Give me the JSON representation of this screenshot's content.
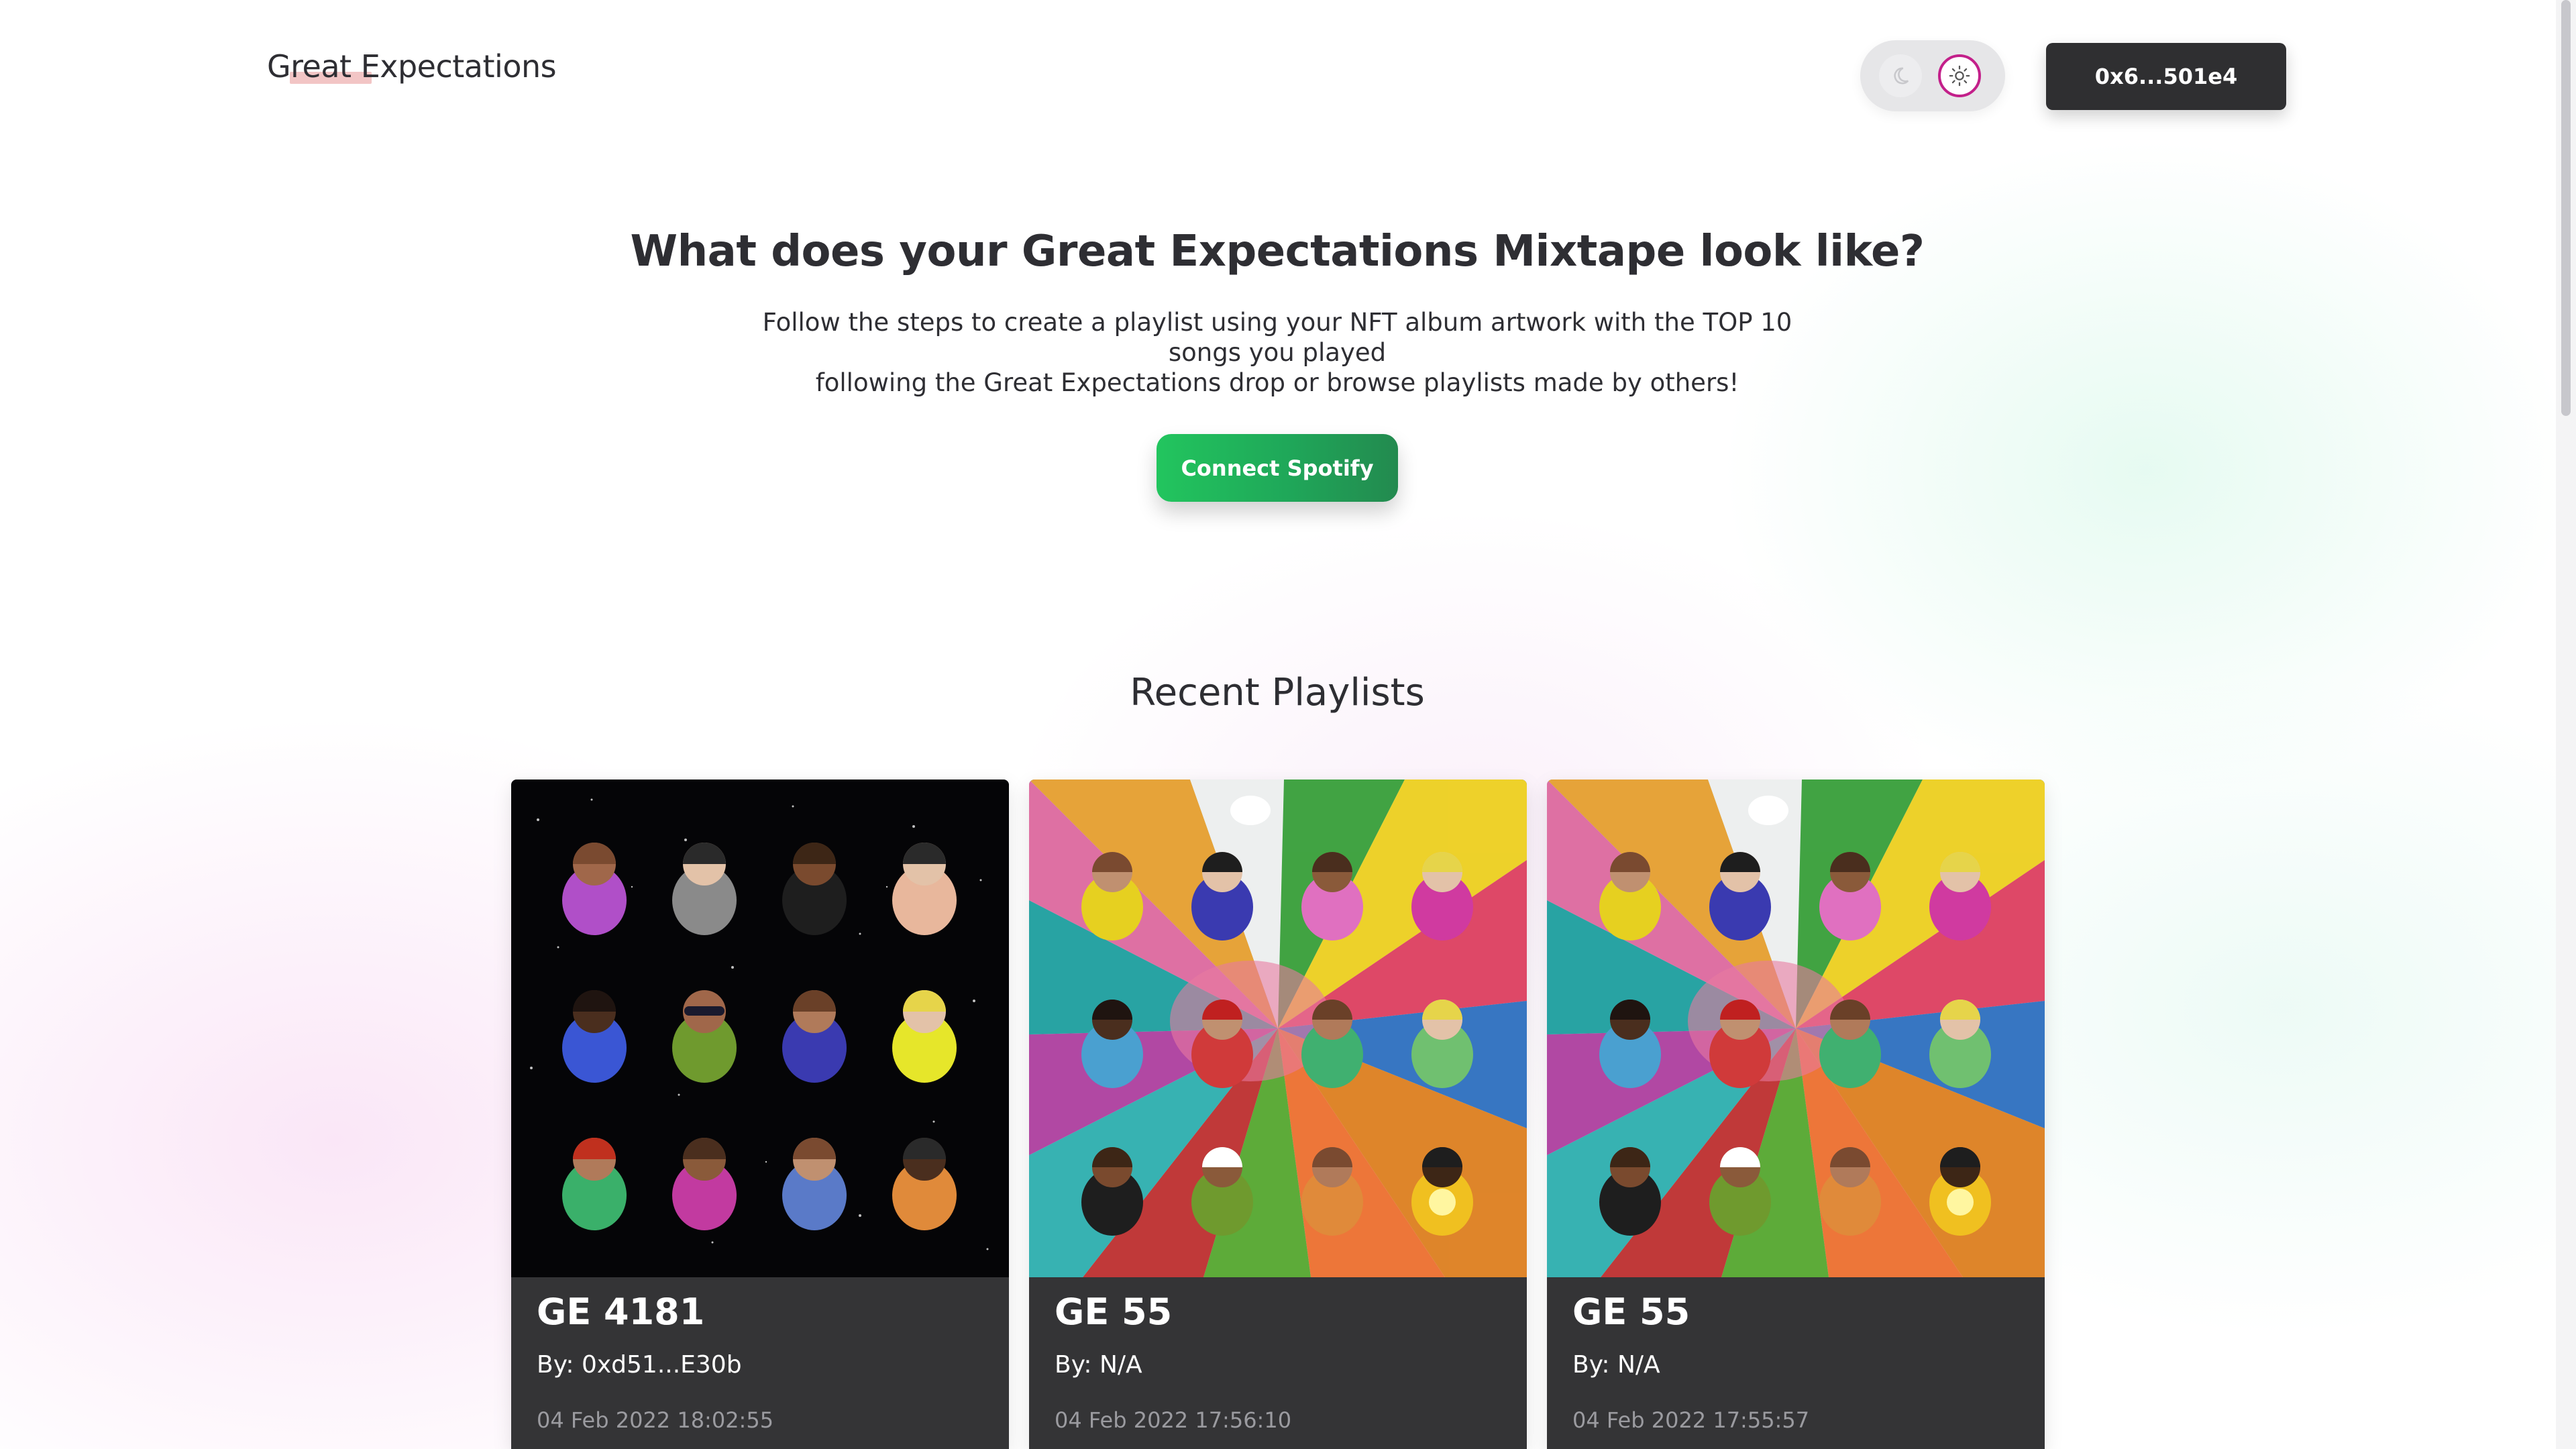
{
  "header": {
    "logo": "Great Expectations",
    "theme_toggle": {
      "dark_icon": "moon-icon",
      "light_icon": "sun-icon",
      "active": "light"
    },
    "wallet": "0x6...501e4"
  },
  "hero": {
    "title": "What does your Great Expectations Mixtape look like?",
    "subtitle_line1": "Follow the steps to create a playlist using your NFT album artwork with the TOP 10 songs you played",
    "subtitle_line2": "following the Great Expectations drop or browse playlists made by others!",
    "cta": "Connect Spotify"
  },
  "recent": {
    "title": "Recent Playlists",
    "cards": [
      {
        "title": "GE 4181",
        "by": "By: 0xd51...E30b",
        "date": "04 Feb 2022 18:02:55",
        "art": "space"
      },
      {
        "title": "GE 55",
        "by": "By: N/A",
        "date": "04 Feb 2022 17:56:10",
        "art": "splash"
      },
      {
        "title": "GE 55",
        "by": "By: N/A",
        "date": "04 Feb 2022 17:55:57",
        "art": "splash"
      }
    ]
  },
  "colors": {
    "accent_magenta": "#c3208a",
    "spotify_green": "#22c55e",
    "dark_button": "#2f2f31",
    "card_bg": "#343436"
  }
}
